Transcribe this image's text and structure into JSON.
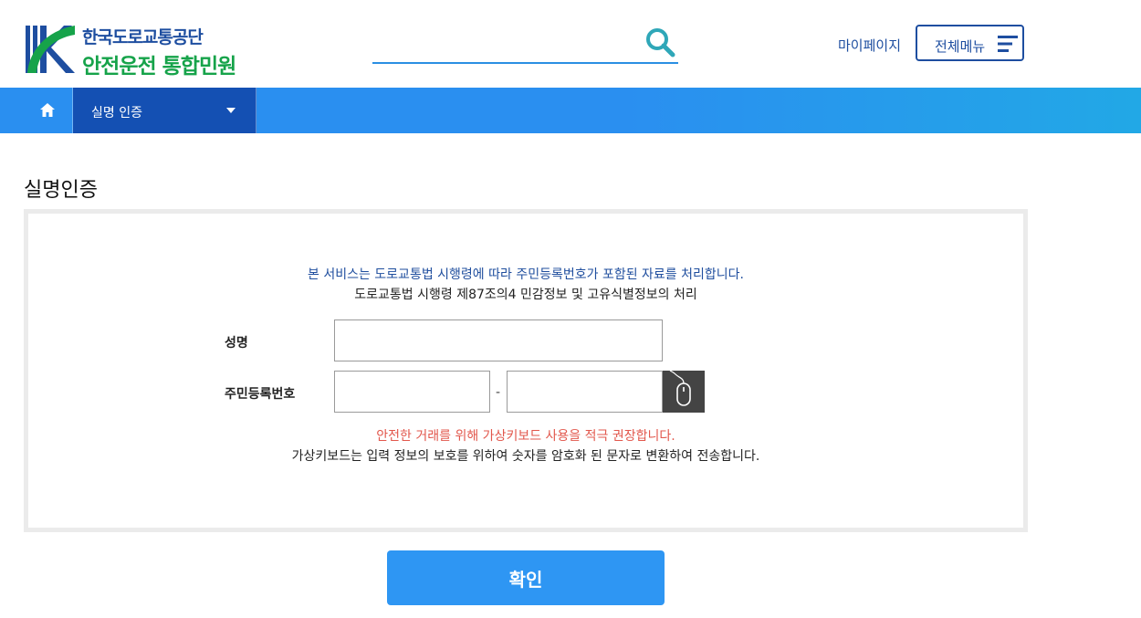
{
  "header": {
    "logo_org": "한국도로교통공단",
    "logo_service": "안전운전 통합민원",
    "search": {
      "value": "",
      "placeholder": ""
    },
    "mypage_label": "마이페이지",
    "allmenu_label": "전체메뉴"
  },
  "nav": {
    "home_icon": "home-icon",
    "current_menu": "실명 인증"
  },
  "page": {
    "title": "실명인증",
    "notice_primary": "본 서비스는 도로교통법 시행령에 따라 주민등록번호가 포함된 자료를 처리합니다.",
    "notice_secondary": "도로교통법 시행령 제87조의4 민감정보 및 고유식별정보의 처리",
    "name_label": "성명",
    "name_value": "",
    "rrn_label": "주민등록번호",
    "rrn_front_value": "",
    "rrn_separator": "-",
    "rrn_back_value": "",
    "vk_icon": "mouse-icon",
    "warning_red": "안전한 거래를 위해 가상키보드 사용을 적극 권장합니다.",
    "warning_info": "가상키보드는 입력 정보의 보호를 위하여 숫자를 암호화 된 문자로 변환하여 전송합니다.",
    "confirm_label": "확인"
  },
  "colors": {
    "brand_blue": "#1e4ea0",
    "brand_green": "#16a34a",
    "nav_blue": "#2a8ff0",
    "nav_active": "#1450b3",
    "warning_red": "#e2574c",
    "confirm_blue": "#2e96f3"
  }
}
